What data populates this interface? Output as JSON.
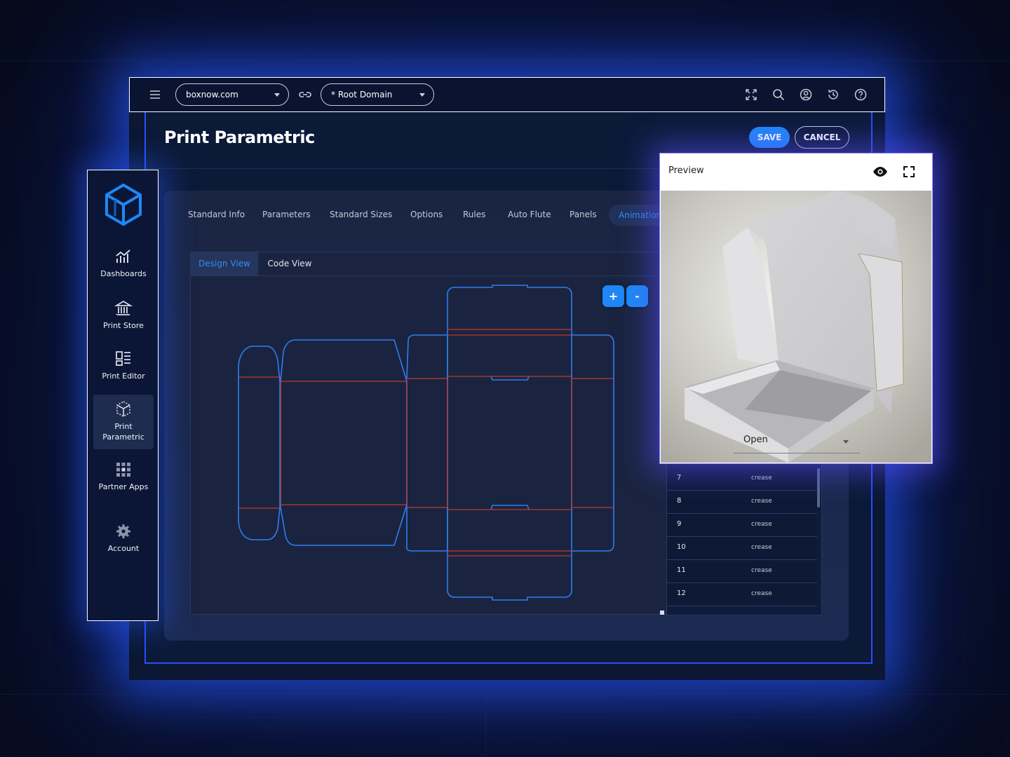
{
  "topbar": {
    "domain_value": "boxnow.com",
    "root_value": "* Root Domain",
    "icons": [
      "menu-icon",
      "link-icon",
      "fullscreen-icon",
      "search-icon",
      "user-icon",
      "history-icon",
      "help-icon"
    ]
  },
  "header": {
    "title": "Print Parametric",
    "save_label": "SAVE",
    "cancel_label": "CANCEL"
  },
  "tabs": [
    {
      "label": "Standard Info"
    },
    {
      "label": "Parameters"
    },
    {
      "label": "Standard Sizes"
    },
    {
      "label": "Options"
    },
    {
      "label": "Rules"
    },
    {
      "label": "Auto Flute"
    },
    {
      "label": "Panels"
    },
    {
      "label": "Animation"
    }
  ],
  "active_tab": "Animation",
  "view_tabs": {
    "design": "Design View",
    "code": "Code View"
  },
  "zoom": {
    "in": "+",
    "out": "-"
  },
  "panel_table": {
    "rows": [
      {
        "num": "7",
        "type": "crease"
      },
      {
        "num": "8",
        "type": "crease"
      },
      {
        "num": "9",
        "type": "crease"
      },
      {
        "num": "10",
        "type": "crease"
      },
      {
        "num": "11",
        "type": "crease"
      },
      {
        "num": "12",
        "type": "crease"
      }
    ]
  },
  "sidebar": {
    "items": [
      {
        "label": "Dashboards",
        "icon": "chart-icon"
      },
      {
        "label": "Print Store",
        "icon": "store-icon"
      },
      {
        "label": "Print Editor",
        "icon": "editor-icon"
      },
      {
        "label": "Print Parametric",
        "icon": "parametric-icon",
        "active": true
      },
      {
        "label": "Partner Apps",
        "icon": "apps-icon"
      },
      {
        "label": "Account",
        "icon": "gear-icon"
      }
    ]
  },
  "preview": {
    "title": "Preview",
    "state_value": "Open"
  },
  "colors": {
    "accent": "#1e88f5",
    "cut_line": "#2f7cf0",
    "crease_line": "#c0392b",
    "glow": "#2b4dff"
  }
}
